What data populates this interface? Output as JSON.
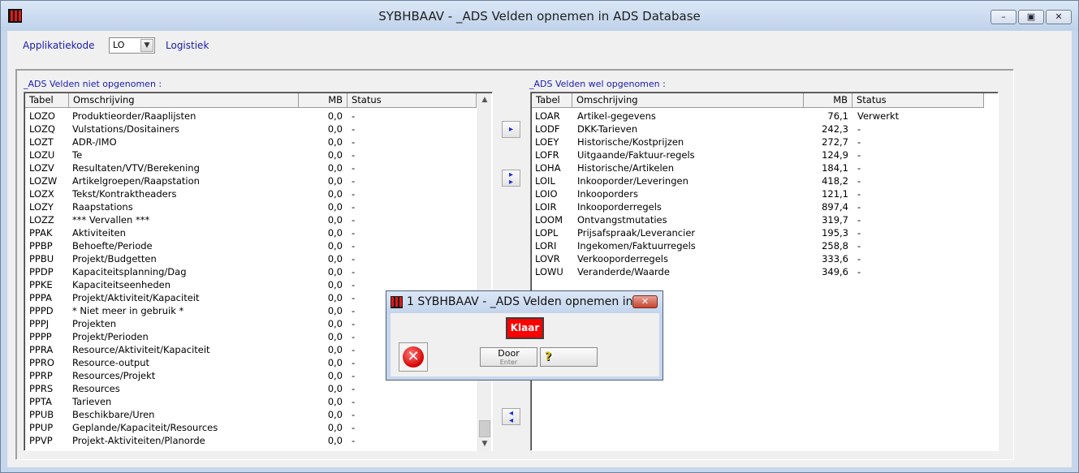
{
  "window": {
    "title": "SYBHBAAV - _ADS Velden opnemen in ADS Database",
    "minimize": "–",
    "maximize": "▣",
    "close": "✕"
  },
  "top": {
    "app_label": "Applikatiekode",
    "app_value": "LO",
    "app_desc": "Logistiek"
  },
  "left": {
    "label": "_ADS Velden niet opgenomen :",
    "headers": {
      "tabel": "Tabel",
      "oms": "Omschrijving",
      "mb": "MB",
      "status": "Status"
    },
    "rows": [
      {
        "tabel": "LOZO",
        "oms": "Produktieorder/Raaplijsten",
        "mb": "0,0",
        "status": "-"
      },
      {
        "tabel": "LOZQ",
        "oms": "Vulstations/Dositainers",
        "mb": "0,0",
        "status": "-"
      },
      {
        "tabel": "LOZT",
        "oms": "ADR-/IMO",
        "mb": "0,0",
        "status": "-"
      },
      {
        "tabel": "LOZU",
        "oms": "Te",
        "mb": "0,0",
        "status": "-"
      },
      {
        "tabel": "LOZV",
        "oms": "Resultaten/VTV/Berekening",
        "mb": "0,0",
        "status": "-"
      },
      {
        "tabel": "LOZW",
        "oms": "Artikelgroepen/Raapstation",
        "mb": "0,0",
        "status": "-"
      },
      {
        "tabel": "LOZX",
        "oms": "Tekst/Kontraktheaders",
        "mb": "0,0",
        "status": "-"
      },
      {
        "tabel": "LOZY",
        "oms": "Raapstations",
        "mb": "0,0",
        "status": "-"
      },
      {
        "tabel": "LOZZ",
        "oms": "*** Vervallen ***",
        "mb": "0,0",
        "status": "-"
      },
      {
        "tabel": "PPAK",
        "oms": "Aktiviteiten",
        "mb": "0,0",
        "status": "-"
      },
      {
        "tabel": "PPBP",
        "oms": "Behoefte/Periode",
        "mb": "0,0",
        "status": "-"
      },
      {
        "tabel": "PPBU",
        "oms": "Projekt/Budgetten",
        "mb": "0,0",
        "status": "-"
      },
      {
        "tabel": "PPDP",
        "oms": "Kapaciteitsplanning/Dag",
        "mb": "0,0",
        "status": "-"
      },
      {
        "tabel": "PPKE",
        "oms": "Kapaciteitseenheden",
        "mb": "0,0",
        "status": "-"
      },
      {
        "tabel": "PPPA",
        "oms": "Projekt/Aktiviteit/Kapaciteit",
        "mb": "0,0",
        "status": "-"
      },
      {
        "tabel": "PPPD",
        "oms": "* Niet meer in gebruik *",
        "mb": "0,0",
        "status": "-"
      },
      {
        "tabel": "PPPJ",
        "oms": "Projekten",
        "mb": "0,0",
        "status": "-"
      },
      {
        "tabel": "PPPP",
        "oms": "Projekt/Perioden",
        "mb": "0,0",
        "status": "-"
      },
      {
        "tabel": "PPRA",
        "oms": "Resource/Aktiviteit/Kapaciteit",
        "mb": "0,0",
        "status": "-"
      },
      {
        "tabel": "PPRO",
        "oms": "Resource-output",
        "mb": "0,0",
        "status": "-"
      },
      {
        "tabel": "PPRP",
        "oms": "Resources/Projekt",
        "mb": "0,0",
        "status": "-"
      },
      {
        "tabel": "PPRS",
        "oms": "Resources",
        "mb": "0,0",
        "status": "-"
      },
      {
        "tabel": "PPTA",
        "oms": "Tarieven",
        "mb": "0,0",
        "status": "-"
      },
      {
        "tabel": "PPUB",
        "oms": "Beschikbare/Uren",
        "mb": "0,0",
        "status": "-"
      },
      {
        "tabel": "PPUP",
        "oms": "Geplande/Kapaciteit/Resources",
        "mb": "0,0",
        "status": "-"
      },
      {
        "tabel": "PPVP",
        "oms": "Projekt-Aktiviteiten/Planorde",
        "mb": "0,0",
        "status": "-"
      }
    ]
  },
  "right": {
    "label": "_ADS Velden wel opgenomen :",
    "headers": {
      "tabel": "Tabel",
      "oms": "Omschrijving",
      "mb": "MB",
      "status": "Status"
    },
    "rows": [
      {
        "tabel": "LOAR",
        "oms": "Artikel-gegevens",
        "mb": "76,1",
        "status": "Verwerkt"
      },
      {
        "tabel": "LODF",
        "oms": "DKK-Tarieven",
        "mb": "242,3",
        "status": "-"
      },
      {
        "tabel": "LOEY",
        "oms": "Historische/Kostprijzen",
        "mb": "272,7",
        "status": "-"
      },
      {
        "tabel": "LOFR",
        "oms": "Uitgaande/Faktuur-regels",
        "mb": "124,9",
        "status": "-"
      },
      {
        "tabel": "LOHA",
        "oms": "Historische/Artikelen",
        "mb": "184,1",
        "status": "-"
      },
      {
        "tabel": "LOIL",
        "oms": "Inkooporder/Leveringen",
        "mb": "418,2",
        "status": "-"
      },
      {
        "tabel": "LOIO",
        "oms": "Inkooporders",
        "mb": "121,1",
        "status": "-"
      },
      {
        "tabel": "LOIR",
        "oms": "Inkooporderregels",
        "mb": "897,4",
        "status": "-"
      },
      {
        "tabel": "LOOM",
        "oms": "Ontvangstmutaties",
        "mb": "319,7",
        "status": "-"
      },
      {
        "tabel": "LOPL",
        "oms": "Prijsafspraak/Leverancier",
        "mb": "195,3",
        "status": "-"
      },
      {
        "tabel": "LORI",
        "oms": "Ingekomen/Faktuurregels",
        "mb": "258,8",
        "status": "-"
      },
      {
        "tabel": "LOVR",
        "oms": "Verkooporderregels",
        "mb": "333,6",
        "status": "-"
      },
      {
        "tabel": "LOWU",
        "oms": "Veranderde/Waarde",
        "mb": "349,6",
        "status": "-"
      }
    ]
  },
  "buttons": {
    "add_one": "▸",
    "add_all": "▸",
    "remove_all": "◂"
  },
  "dialog": {
    "title": "1 SYBHBAAV - _ADS Velden opnemen in...",
    "close": "✕",
    "status": "Klaar",
    "error_glyph": "✕",
    "door_label": "Door",
    "door_sub": "Enter",
    "help_glyph": "?"
  }
}
